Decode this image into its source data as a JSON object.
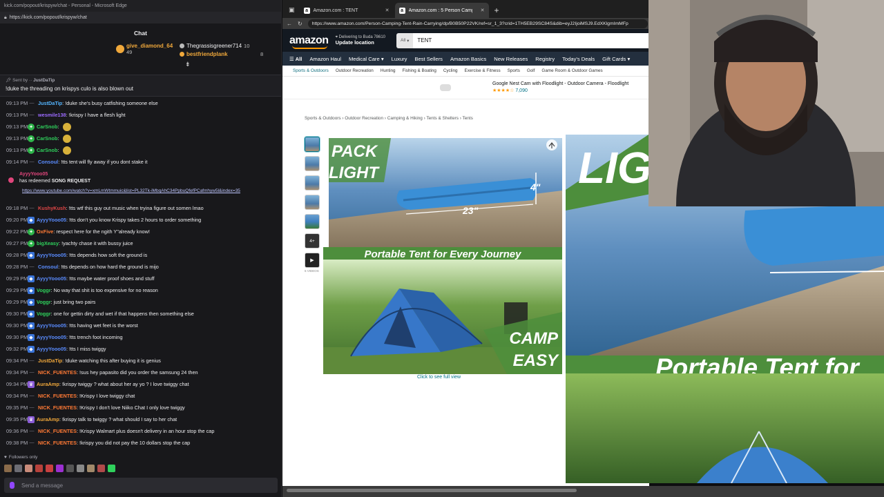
{
  "chat_window": {
    "title": "kick.com/popout/krispyw/chat - Personal - Microsoft Edge",
    "url": "https://kick.com/popout/krispyw/chat",
    "header": "Chat",
    "gifters": [
      {
        "name": "give_diamond_64",
        "count": "49",
        "color": "#f0a83b"
      },
      {
        "name": "Thegrassisgreener714",
        "count": "10",
        "color": "#efeff1"
      },
      {
        "name": "bestfriendplank",
        "count": "8",
        "color": "#f0a83b"
      }
    ],
    "pinned": {
      "label": "Sent by",
      "user": "JustDaTip",
      "text": "!duke the threading on krispys culo is also blown out"
    },
    "messages": [
      {
        "time": "09:13 PM",
        "badge": "",
        "user": "JustDaTip",
        "color": "#54b5ff",
        "text": "!duke she's busy catfishing someone else"
      },
      {
        "time": "09:13 PM",
        "badge": "",
        "user": "wesmile138",
        "color": "#9c6bff",
        "text": "!krispy I have a flesh light"
      },
      {
        "time": "09:13 PM",
        "badge": "green",
        "user": "CarSnob",
        "color": "#2fd15c",
        "text": "",
        "emote": true
      },
      {
        "time": "09:13 PM",
        "badge": "green",
        "user": "CarSnob",
        "color": "#2fd15c",
        "text": "",
        "emote": true
      },
      {
        "time": "09:13 PM",
        "badge": "green",
        "user": "CarSnob",
        "color": "#2fd15c",
        "text": "",
        "emote": true
      },
      {
        "time": "09:14 PM",
        "badge": "",
        "user": "Consoul",
        "color": "#5b8dff",
        "text": "!tts tent will fly away if you dont stake it"
      }
    ],
    "redeem": {
      "user": "AyyyYooo05",
      "action": "has redeemed",
      "reward": "SONG REQUEST",
      "link": "https://www.youtube.com/watch?v=xmLmWtmmuic&list=PL32Tk-iMbqAhC34PpbuQfefPCafmhyw5l&index=35"
    },
    "messages2": [
      {
        "time": "09:18 PM",
        "badge": "",
        "user": "KushyKush",
        "color": "#e04646",
        "text": "!tts wtf this guy out music when tryina figure out somen lmao"
      },
      {
        "time": "09:20 PM",
        "badge": "blue",
        "user": "AyyyYooo05",
        "color": "#5a8cff",
        "text": "!tts don't you know Krispy takes 2 hours to order something"
      },
      {
        "time": "09:22 PM",
        "badge": "green",
        "user": "OxFive",
        "color": "#ff7a35",
        "text": "respect  here for the ngith Y\"already know!"
      },
      {
        "time": "09:27 PM",
        "badge": "green",
        "user": "bigXeasy",
        "color": "#2fd15c",
        "text": "!yachty chase it with bussy juice"
      },
      {
        "time": "09:28 PM",
        "badge": "blue",
        "user": "AyyyYooo05",
        "color": "#5a8cff",
        "text": "!tts depends how soft the ground is"
      },
      {
        "time": "09:28 PM",
        "badge": "",
        "user": "Consoul",
        "color": "#5b8dff",
        "text": "!tts depends on how hard the ground is mijo"
      },
      {
        "time": "09:29 PM",
        "badge": "blue",
        "user": "AyyyYooo05",
        "color": "#5a8cff",
        "text": "!tts maybe water proof shoes and stuff"
      },
      {
        "time": "09:29 PM",
        "badge": "blue",
        "user": "Voggr",
        "color": "#2fd15c",
        "text": "No way that shit is too expensive for no reason"
      },
      {
        "time": "09:29 PM",
        "badge": "blue",
        "user": "Voggr",
        "color": "#2fd15c",
        "text": "just bring two pairs"
      },
      {
        "time": "09:30 PM",
        "badge": "blue",
        "user": "Voggr",
        "color": "#2fd15c",
        "text": "one for gettin dirty and wet if that happens then something else"
      },
      {
        "time": "09:30 PM",
        "badge": "blue",
        "user": "AyyyYooo05",
        "color": "#5a8cff",
        "text": "!tts having wet feet is the worst"
      },
      {
        "time": "09:30 PM",
        "badge": "blue",
        "user": "AyyyYooo05",
        "color": "#5a8cff",
        "text": "!tts trench foot incoming"
      },
      {
        "time": "09:32 PM",
        "badge": "blue",
        "user": "AyyyYooo05",
        "color": "#5a8cff",
        "text": "!tts I miss twiggy"
      },
      {
        "time": "09:34 PM",
        "badge": "",
        "user": "JustDaTip",
        "color": "#f0a83b",
        "text": "!duke watching this after buying it is genius"
      },
      {
        "time": "09:34 PM",
        "badge": "",
        "user": "NICK_FUENTES",
        "color": "#ff7a35",
        "text": "!sus hey papasito did you order the samsung 24 then"
      },
      {
        "time": "09:34 PM",
        "badge": "purple",
        "user": "AuraAmp",
        "color": "#f0a83b",
        "text": "!krispy twiggy ? what about her ay yo ? I love twiggy chat"
      },
      {
        "time": "09:34 PM",
        "badge": "",
        "user": "NICK_FUENTES",
        "color": "#ff7a35",
        "text": "!Krispy I love twiggy chat"
      },
      {
        "time": "09:35 PM",
        "badge": "",
        "user": "NICK_FUENTES",
        "color": "#ff7a35",
        "text": "!Krispy I don't love Niiko Chat I only love twiggy"
      },
      {
        "time": "09:35 PM",
        "badge": "purple",
        "user": "AuraAmp",
        "color": "#f0a83b",
        "text": "!krispy talk to twiggy ? what should I say to her chat"
      },
      {
        "time": "09:36 PM",
        "badge": "",
        "user": "NICK_FUENTES",
        "color": "#ff7a35",
        "text": "!Krispy Walmart plus doesn't delivery in an hour stop the cap"
      },
      {
        "time": "09:38 PM",
        "badge": "",
        "user": "NICK_FUENTES",
        "color": "#ff7a35",
        "text": "!krispy you did not pay the 10 dollars stop the cap"
      }
    ],
    "followers_only": "Followers only",
    "send_placeholder": "Send a message"
  },
  "browser": {
    "tabs": [
      {
        "label": "Amazon.com : TENT",
        "active": false
      },
      {
        "label": "Amazon.com : 5 Person Camping...",
        "active": true
      }
    ],
    "url": "https://www.amazon.com/Person-Camping-Tent-Rain-Carrying/dp/B0B50P22VK/ref=sr_1_3?crid=1TH5EB29SC84S&dib=eyJ2IjoiMSJ9.EdXKlgmImMFp"
  },
  "amazon": {
    "logo": "amazon",
    "deliver_line1": "Delivering to Buda 78610",
    "deliver_line2": "Update location",
    "search_category": "All",
    "search_value": "TENT",
    "nav": [
      "All",
      "Amazon Haul",
      "Medical Care",
      "Luxury",
      "Best Sellers",
      "Amazon Basics",
      "New Releases",
      "Registry",
      "Today's Deals",
      "Gift Cards"
    ],
    "subnav": [
      "Sports & Outdoors",
      "Outdoor Recreation",
      "Hunting",
      "Fishing & Boating",
      "Cycling",
      "Exercise & Fitness",
      "Sports",
      "Golf",
      "Game Room & Outdoor Games"
    ],
    "ad_title": "Google Nest Cam with Floodlight - Outdoor Camera - Floodlight",
    "ad_stars": "★★★★☆",
    "ad_count": "7,090",
    "breadcrumb": "Sports & Outdoors  ›  Outdoor Recreation  ›  Camping & Hiking  ›  Tents & Shelters  ›  Tents",
    "thumb_more": "4+",
    "videos_label": "6 VIDEOS",
    "image_text": {
      "pack": "PACK",
      "light": "LIGHT",
      "dim_height": "4\"",
      "dim_length": "23\"",
      "banner": "Portable Tent for Every Journey",
      "camp": "CAMP",
      "easy": "EASY"
    },
    "click_full": "Click to see full view"
  },
  "zoom_text": {
    "lig": "LIG",
    "banner": "Portable Tent for"
  }
}
